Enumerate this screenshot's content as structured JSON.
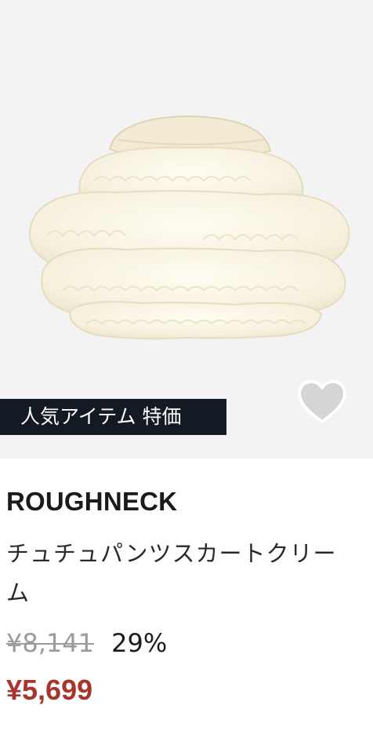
{
  "product": {
    "badge": "人気アイテム 特価",
    "brand": "ROUGHNECK",
    "name": "チュチュパンツスカートクリーム",
    "original_price": "¥8,141",
    "discount": "29%",
    "sale_price": "¥5,699"
  },
  "icons": {
    "favorite": "heart-icon"
  },
  "colors": {
    "image_bg": "#f4f3f4",
    "badge_bg": "#141a24",
    "sale_price": "#a8352b",
    "heart": "#d5d5d5"
  }
}
